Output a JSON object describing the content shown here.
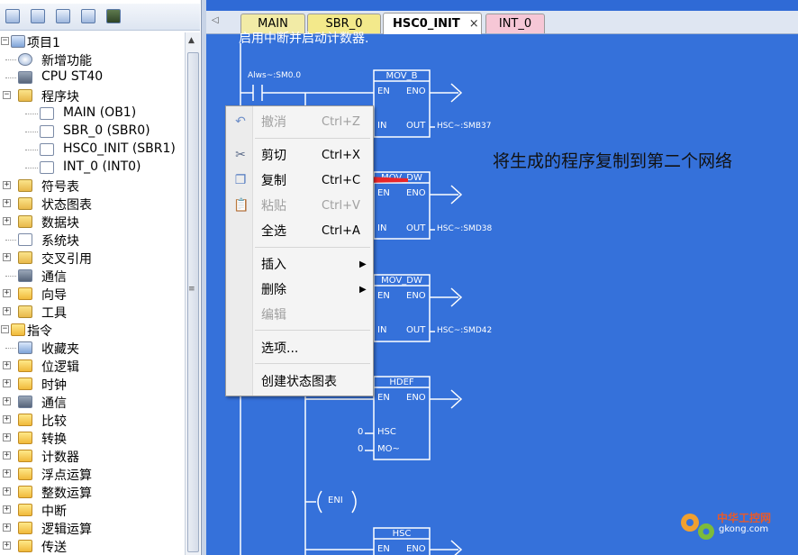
{
  "tree": {
    "items": [
      {
        "label": "项目1",
        "level": 0,
        "expander": "-",
        "icon": "project-icon"
      },
      {
        "label": "新增功能",
        "level": 1,
        "expander": "",
        "icon": "help-icon"
      },
      {
        "label": "CPU ST40",
        "level": 1,
        "expander": "",
        "icon": "cpu-icon"
      },
      {
        "label": "程序块",
        "level": 1,
        "expander": "-",
        "icon": "folder-icon"
      },
      {
        "label": "MAIN (OB1)",
        "level": 2,
        "expander": "",
        "icon": "program-page-icon"
      },
      {
        "label": "SBR_0 (SBR0)",
        "level": 2,
        "expander": "",
        "icon": "program-page-icon"
      },
      {
        "label": "HSC0_INIT (SBR1)",
        "level": 2,
        "expander": "",
        "icon": "program-page-icon"
      },
      {
        "label": "INT_0 (INT0)",
        "level": 2,
        "expander": "",
        "icon": "program-page-icon"
      },
      {
        "label": "符号表",
        "level": 1,
        "expander": "+",
        "icon": "folder-icon"
      },
      {
        "label": "状态图表",
        "level": 1,
        "expander": "+",
        "icon": "folder-icon"
      },
      {
        "label": "数据块",
        "level": 1,
        "expander": "+",
        "icon": "folder-icon"
      },
      {
        "label": "系统块",
        "level": 1,
        "expander": "",
        "icon": "system-block-icon"
      },
      {
        "label": "交叉引用",
        "level": 1,
        "expander": "+",
        "icon": "folder-icon"
      },
      {
        "label": "通信",
        "level": 1,
        "expander": "",
        "icon": "communication-icon"
      },
      {
        "label": "向导",
        "level": 1,
        "expander": "+",
        "icon": "wizard-icon"
      },
      {
        "label": "工具",
        "level": 1,
        "expander": "+",
        "icon": "folder-icon"
      },
      {
        "label": "指令",
        "level": 0,
        "expander": "-",
        "icon": "instructions-icon"
      },
      {
        "label": "收藏夹",
        "level": 1,
        "expander": "",
        "icon": "favorites-icon"
      },
      {
        "label": "位逻辑",
        "level": 1,
        "expander": "+",
        "icon": "bit-logic-icon"
      },
      {
        "label": "时钟",
        "level": 1,
        "expander": "+",
        "icon": "clock-icon"
      },
      {
        "label": "通信",
        "level": 1,
        "expander": "+",
        "icon": "communication-icon"
      },
      {
        "label": "比较",
        "level": 1,
        "expander": "+",
        "icon": "compare-icon"
      },
      {
        "label": "转换",
        "level": 1,
        "expander": "+",
        "icon": "convert-icon"
      },
      {
        "label": "计数器",
        "level": 1,
        "expander": "+",
        "icon": "counter-icon"
      },
      {
        "label": "浮点运算",
        "level": 1,
        "expander": "+",
        "icon": "float-math-icon"
      },
      {
        "label": "整数运算",
        "level": 1,
        "expander": "+",
        "icon": "integer-math-icon"
      },
      {
        "label": "中断",
        "level": 1,
        "expander": "+",
        "icon": "interrupt-icon"
      },
      {
        "label": "逻辑运算",
        "level": 1,
        "expander": "+",
        "icon": "logic-ops-icon"
      },
      {
        "label": "传送",
        "level": 1,
        "expander": "+",
        "icon": "move-icon"
      }
    ]
  },
  "tabs": [
    {
      "label": "MAIN"
    },
    {
      "label": "SBR_0"
    },
    {
      "label": "HSC0_INIT",
      "close": "×",
      "active": true
    },
    {
      "label": "INT_0"
    }
  ],
  "editor": {
    "comment": "启用中断并启动计数器.",
    "contact_label": "Alws~:SM0.0",
    "blocks": [
      {
        "name": "MOV_B",
        "en": "EN",
        "eno": "ENO",
        "in": "IN",
        "out": "OUT",
        "out_addr": "HSC~:SMB37"
      },
      {
        "name": "MOV_DW",
        "en": "EN",
        "eno": "ENO",
        "in": "IN",
        "out": "OUT",
        "out_addr": "HSC~:SMD38"
      },
      {
        "name": "MOV_DW",
        "en": "EN",
        "eno": "ENO",
        "in": "IN",
        "out": "OUT",
        "out_addr": "HSC~:SMD42"
      },
      {
        "name": "HDEF",
        "en": "EN",
        "eno": "ENO",
        "p1": "HSC",
        "p2": "MO~",
        "p1_val": "0",
        "p2_val": "0"
      },
      {
        "name": "HSC",
        "en": "EN",
        "eno": "ENO"
      }
    ],
    "eni_label": "ENI",
    "annotation": "将生成的程序复制到第二个网络"
  },
  "context_menu": {
    "items": [
      {
        "label": "撤消",
        "shortcut": "Ctrl+Z",
        "disabled": true,
        "icon": "undo-icon"
      },
      {
        "label": "剪切",
        "shortcut": "Ctrl+X",
        "disabled": false,
        "icon": "cut-icon"
      },
      {
        "label": "复制",
        "shortcut": "Ctrl+C",
        "disabled": false,
        "icon": "copy-icon"
      },
      {
        "label": "粘贴",
        "shortcut": "Ctrl+V",
        "disabled": true,
        "icon": "paste-icon"
      },
      {
        "label": "全选",
        "shortcut": "Ctrl+A",
        "disabled": false,
        "icon": ""
      },
      {
        "label": "插入",
        "shortcut": "",
        "disabled": false,
        "submenu": true
      },
      {
        "label": "删除",
        "shortcut": "",
        "disabled": false,
        "submenu": true
      },
      {
        "label": "编辑",
        "shortcut": "",
        "disabled": true
      },
      {
        "label": "选项...",
        "shortcut": "",
        "disabled": false
      },
      {
        "label": "创建状态图表",
        "shortcut": "",
        "disabled": false
      }
    ]
  },
  "watermark": {
    "line1": "中华工控网",
    "line2": "gkong.com"
  },
  "colors": {
    "editor_bg": "#3571da",
    "arrow": "#e8262a",
    "tab_main": "#f2eba6",
    "tab_sbr": "#f3e98b",
    "tab_int": "#f6c7d6"
  }
}
